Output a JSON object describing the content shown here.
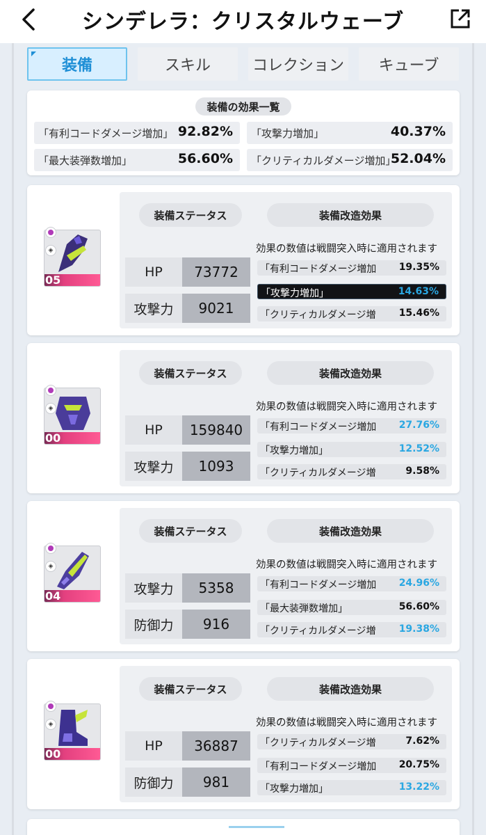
{
  "header": {
    "title": "シンデレラ：クリスタルウェーブ"
  },
  "tabs": [
    {
      "label": "装備",
      "active": true
    },
    {
      "label": "スキル"
    },
    {
      "label": "コレクション"
    },
    {
      "label": "キューブ"
    }
  ],
  "summary": {
    "heading": "装備の効果一覧",
    "items": [
      {
        "label": "「有利コードダメージ増加」",
        "value": "92.82%"
      },
      {
        "label": "「攻撃力増加」",
        "value": "40.37%"
      },
      {
        "label": "「最大装弾数増加」",
        "value": "56.60%"
      },
      {
        "label": "「クリティカルダメージ増加」",
        "value": "52.04%"
      }
    ]
  },
  "common": {
    "status_heading": "装備ステータス",
    "effect_heading": "装備改造効果",
    "note": "効果の数値は戦闘突入時に適用されます"
  },
  "colors": {
    "accent_blue": "#2aa7e2",
    "tab_active_bg": "#d8efff",
    "level_bar": "#ff5a94"
  },
  "equipment": [
    {
      "level": "05",
      "stats": [
        {
          "label": "HP",
          "value": "73772"
        },
        {
          "label": "攻撃力",
          "value": "9021"
        }
      ],
      "effects": [
        {
          "label": "「有利コードダメージ増加",
          "value": "19.35%",
          "blue": false,
          "highlighted": false
        },
        {
          "label": "「攻撃力増加」",
          "value": "14.63%",
          "blue": true,
          "highlighted": true
        },
        {
          "label": "「クリティカルダメージ増",
          "value": "15.46%",
          "blue": false,
          "highlighted": false
        }
      ]
    },
    {
      "level": "00",
      "stats": [
        {
          "label": "HP",
          "value": "159840"
        },
        {
          "label": "攻撃力",
          "value": "1093"
        }
      ],
      "effects": [
        {
          "label": "「有利コードダメージ増加",
          "value": "27.76%",
          "blue": true,
          "highlighted": false
        },
        {
          "label": "「攻撃力増加」",
          "value": "12.52%",
          "blue": true,
          "highlighted": false
        },
        {
          "label": "「クリティカルダメージ増",
          "value": "9.58%",
          "blue": false,
          "highlighted": false
        }
      ]
    },
    {
      "level": "04",
      "stats": [
        {
          "label": "攻撃力",
          "value": "5358"
        },
        {
          "label": "防御力",
          "value": "916"
        }
      ],
      "effects": [
        {
          "label": "「有利コードダメージ増加",
          "value": "24.96%",
          "blue": true,
          "highlighted": false
        },
        {
          "label": "「最大装弾数増加」",
          "value": "56.60%",
          "blue": false,
          "highlighted": false
        },
        {
          "label": "「クリティカルダメージ増",
          "value": "19.38%",
          "blue": true,
          "highlighted": false
        }
      ]
    },
    {
      "level": "00",
      "stats": [
        {
          "label": "HP",
          "value": "36887"
        },
        {
          "label": "防御力",
          "value": "981"
        }
      ],
      "effects": [
        {
          "label": "「クリティカルダメージ増",
          "value": "7.62%",
          "blue": false,
          "highlighted": false
        },
        {
          "label": "「有利コードダメージ増加",
          "value": "20.75%",
          "blue": false,
          "highlighted": false
        },
        {
          "label": "「攻撃力増加」",
          "value": "13.22%",
          "blue": true,
          "highlighted": false
        }
      ]
    }
  ]
}
